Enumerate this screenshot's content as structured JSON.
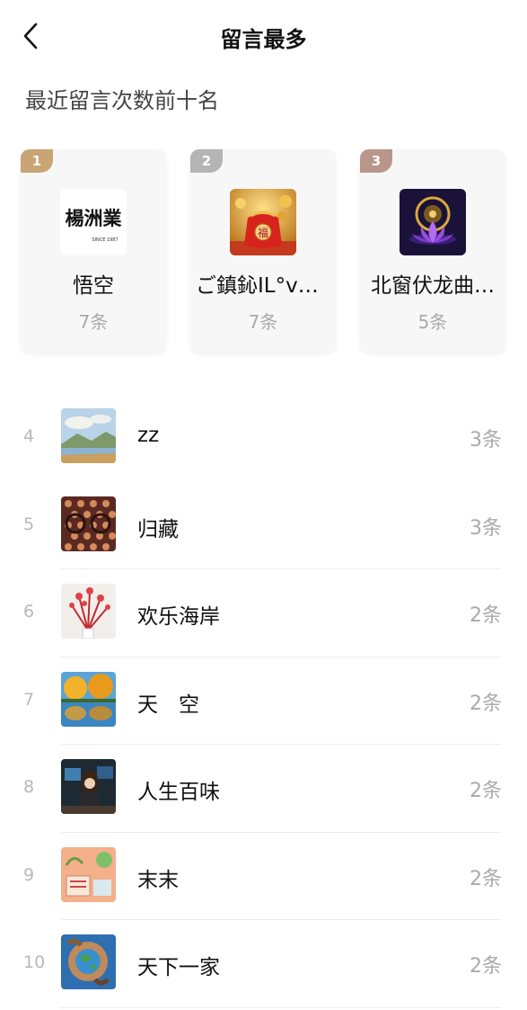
{
  "header": {
    "title": "留言最多"
  },
  "subtitle": "最近留言次数前十名",
  "colors": {
    "gold": "#c9a474",
    "silver": "#b4b4b4",
    "bronze": "#b8978a"
  },
  "top3": [
    {
      "rank": "1",
      "name": "悟空",
      "count": "7条",
      "avatar_icon": "calligraphy-logo",
      "logo_text": "楊洲業",
      "logo_sub": "SINCE 1987"
    },
    {
      "rank": "2",
      "name": "ご鎮鈊IL°ve…",
      "count": "7条",
      "avatar_icon": "fortune-bag",
      "bag_char": "福"
    },
    {
      "rank": "3",
      "name": "北窗伏龙曲…",
      "count": "5条",
      "avatar_icon": "lotus"
    }
  ],
  "list": [
    {
      "rank": "4",
      "name": "zz",
      "count": "3条",
      "avatar_icon": "landscape-painting"
    },
    {
      "rank": "5",
      "name": "归藏",
      "count": "3条",
      "avatar_icon": "optical-illusion"
    },
    {
      "rank": "6",
      "name": "欢乐海岸",
      "count": "2条",
      "avatar_icon": "red-flowers"
    },
    {
      "rank": "7",
      "name": "天　空",
      "count": "2条",
      "avatar_icon": "autumn-trees"
    },
    {
      "rank": "8",
      "name": "人生百味",
      "count": "2条",
      "avatar_icon": "woman-at-desk"
    },
    {
      "rank": "9",
      "name": "末末",
      "count": "2条",
      "avatar_icon": "illustration-card"
    },
    {
      "rank": "10",
      "name": "天下一家",
      "count": "2条",
      "avatar_icon": "hands-globe"
    }
  ]
}
